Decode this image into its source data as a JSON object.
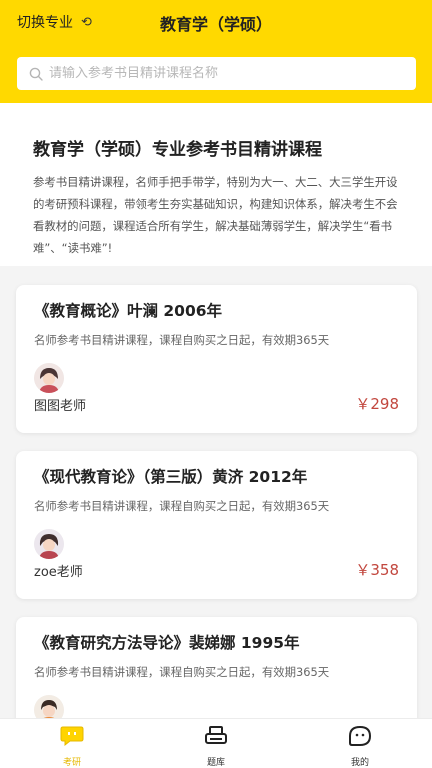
{
  "header": {
    "switch_label": "切换专业",
    "title": "教育学（学硕）",
    "search_placeholder": "请输入参考书目精讲课程名称"
  },
  "intro": {
    "title": "教育学（学硕）专业参考书目精讲课程",
    "desc": "参考书目精讲课程，名师手把手带学，特别为大一、大二、大三学生开设的考研预科课程，带领考生夯实基础知识，构建知识体系，解决考生不会看教材的问题，课程适合所有学生，解决基础薄弱学生，解决学生“看书难”、“读书难”!"
  },
  "courses": [
    {
      "title": "《教育概论》叶澜 2006年",
      "desc": "名师参考书目精讲课程，课程自购买之日起，有效期365天",
      "teacher": "图图老师",
      "price": "￥298"
    },
    {
      "title": "《现代教育论》（第三版）黄济 2012年",
      "desc": "名师参考书目精讲课程，课程自购买之日起，有效期365天",
      "teacher": "zoe老师",
      "price": "￥358"
    },
    {
      "title": "《教育研究方法导论》裴娣娜 1995年",
      "desc": "名师参考书目精讲课程，课程自购买之日起，有效期365天",
      "teacher": "",
      "price": ""
    }
  ],
  "tabs": [
    {
      "label": "考研",
      "icon": "chat-icon",
      "active": true
    },
    {
      "label": "题库",
      "icon": "printer-icon",
      "active": false
    },
    {
      "label": "我的",
      "icon": "face-icon",
      "active": false
    }
  ],
  "colors": {
    "accent": "#ffd900",
    "price": "#c2473e",
    "active_tab": "#e6b800"
  }
}
